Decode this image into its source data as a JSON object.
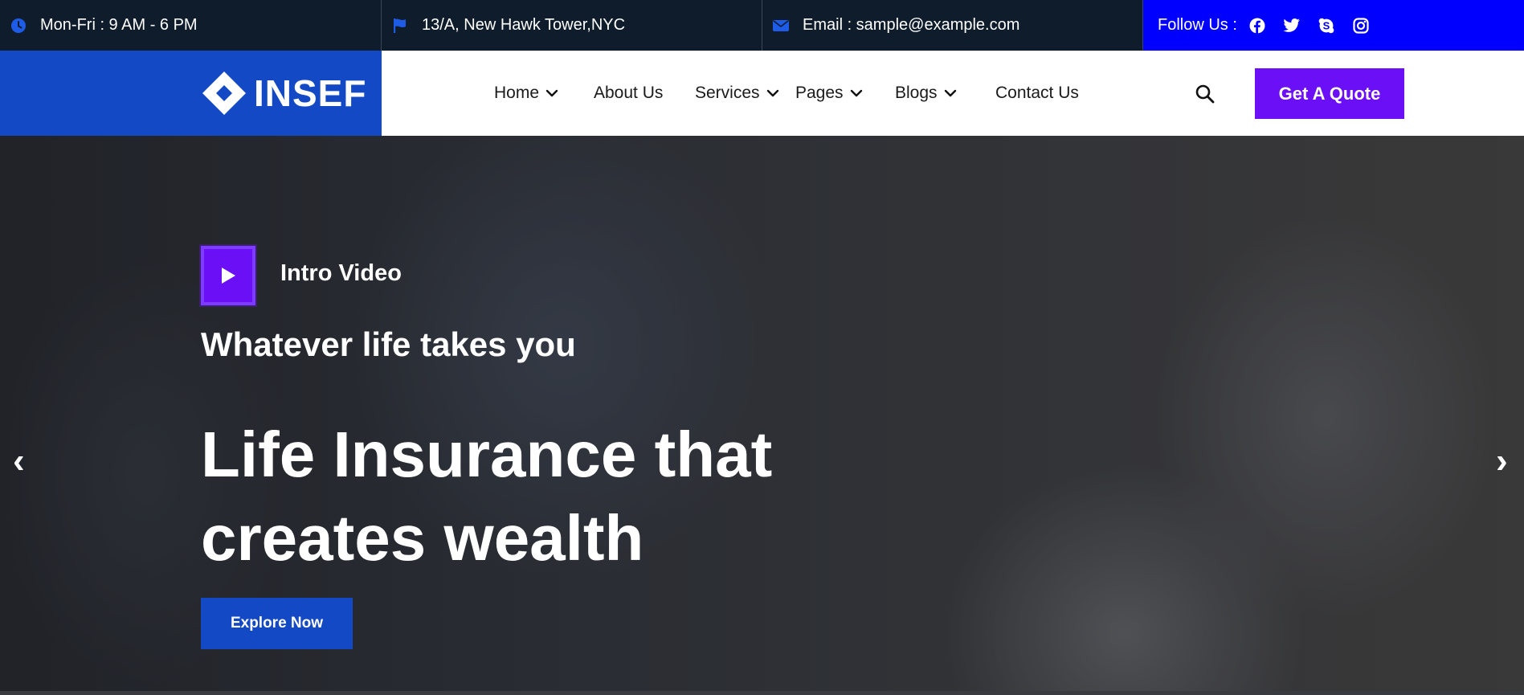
{
  "topbar": {
    "hours": "Mon-Fri : 9 AM - 6 PM",
    "address": "13/A, New Hawk Tower,NYC",
    "email": "Email : sample@example.com",
    "follow_label": "Follow Us :",
    "icons": [
      "clock-icon",
      "flag-icon",
      "envelope-icon"
    ],
    "social": [
      "facebook-icon",
      "twitter-icon",
      "skype-icon",
      "instagram-icon"
    ]
  },
  "header": {
    "logo_text": "INSEF",
    "nav": [
      {
        "label": "Home",
        "dropdown": true
      },
      {
        "label": "About Us",
        "dropdown": false
      },
      {
        "label": "Services",
        "dropdown": true
      },
      {
        "label": "Pages",
        "dropdown": true
      },
      {
        "label": "Blogs",
        "dropdown": true
      },
      {
        "label": "Contact Us",
        "dropdown": false
      }
    ],
    "quote_button": "Get A Quote"
  },
  "hero": {
    "intro_label": "Intro Video",
    "tagline": "Whatever life takes you",
    "headline": "Life Insurance that creates wealth",
    "cta": "Explore Now",
    "prev_arrow": "‹",
    "next_arrow": "›"
  },
  "colors": {
    "topbar_bg": "#0f1c2b",
    "follow_bg": "#0000ff",
    "brand_blue": "#1349c4",
    "accent_purple": "#6b0ff7"
  }
}
